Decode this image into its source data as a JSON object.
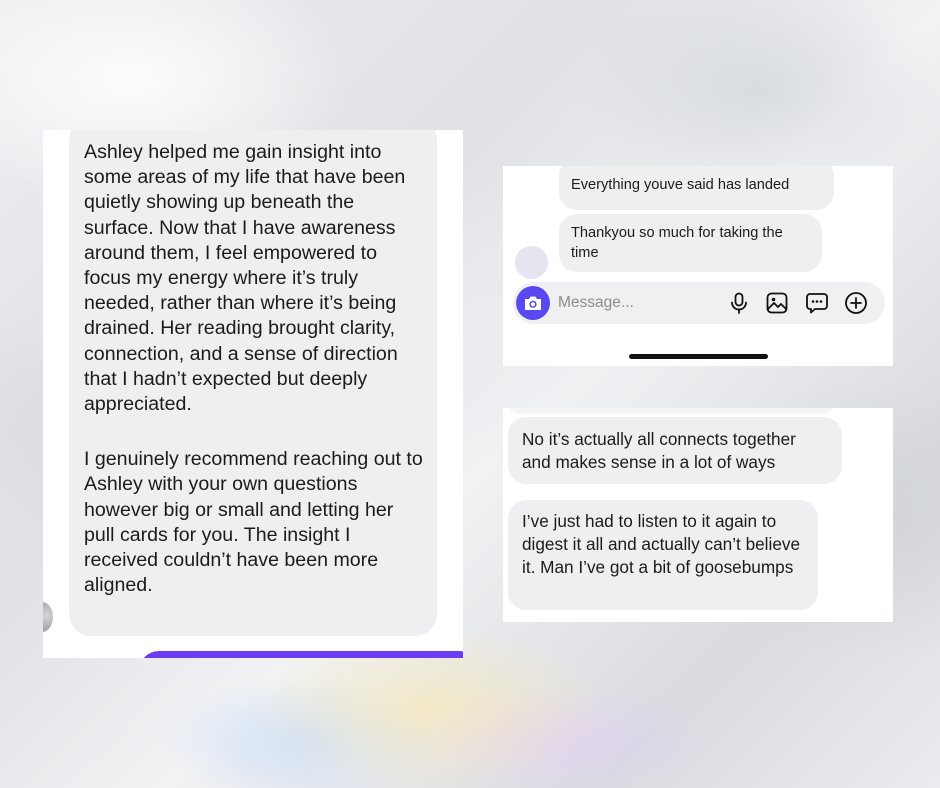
{
  "left_screenshot": {
    "received_paragraphs": [
      "Ashley helped me gain insight into some areas of my life that have been quietly showing up beneath the surface. Now that I have awareness around them, I feel empowered to focus my energy where it’s truly needed, rather than where it’s being drained. Her reading brought clarity, connection, and a sense of direction that I hadn’t expected but deeply appreciated.",
      "I genuinely recommend reaching out to Ashley with your own questions however big or small and letting her pull cards for you. The insight I received couldn’t have been more aligned."
    ],
    "sent_bubble_color": "#6a3df2"
  },
  "top_right_screenshot": {
    "messages": [
      "Everything youve said has landed",
      "Thankyou so much for taking the time"
    ],
    "composer": {
      "placeholder": "Message...",
      "icons": [
        "camera-icon",
        "microphone-icon",
        "gallery-icon",
        "sticker-icon",
        "add-icon"
      ],
      "accent": "#5a49f0"
    }
  },
  "bottom_right_screenshot": {
    "messages": [
      "No it’s actually all connects together and makes sense in a lot of ways",
      "I’ve just had to listen to it again to digest it all and actually can’t believe it. Man I’ve got a bit of goosebumps"
    ]
  }
}
